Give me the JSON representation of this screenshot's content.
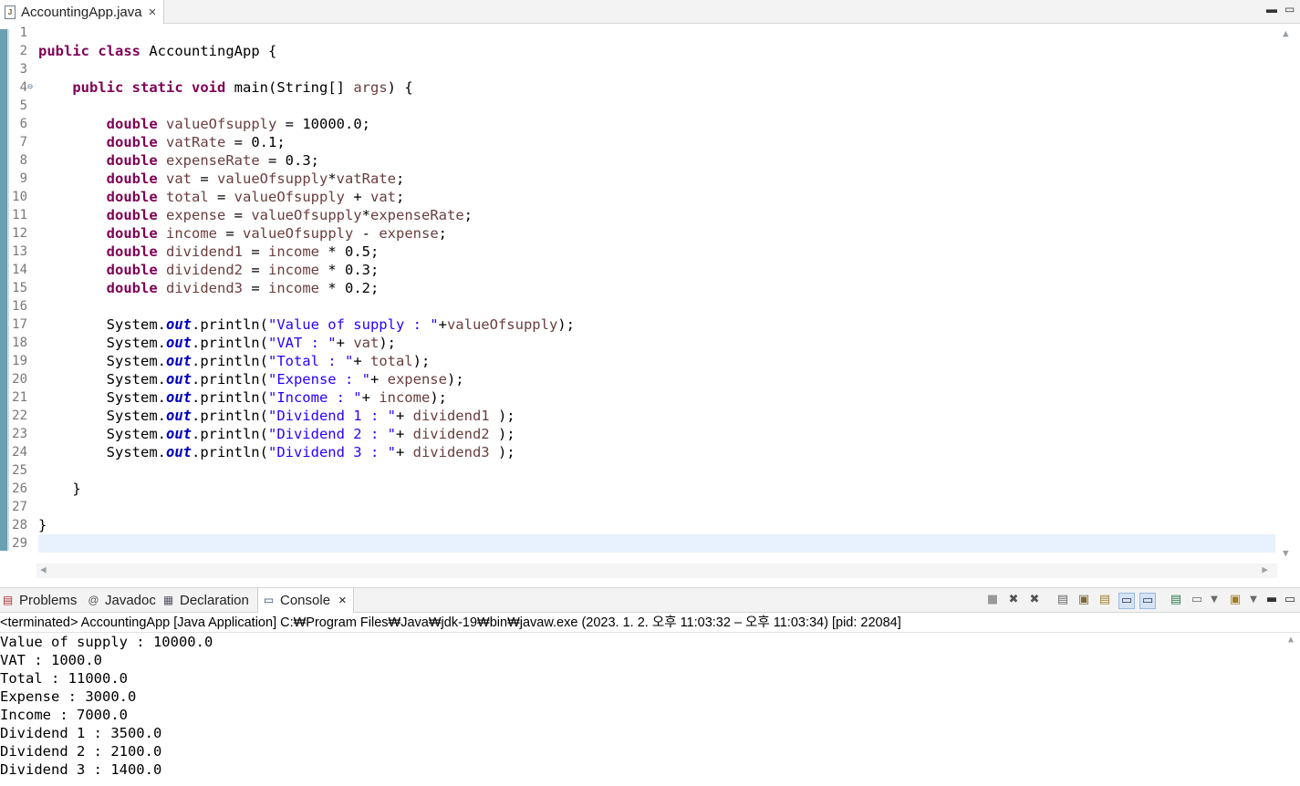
{
  "editor": {
    "tab": {
      "filename": "AccountingApp.java",
      "file_icon": "java-file-icon",
      "close": "×"
    },
    "window_buttons": {
      "minimize": "▬",
      "maximize": "▭"
    },
    "line_numbers": [
      "1",
      "2",
      "3",
      "4",
      "5",
      "6",
      "7",
      "8",
      "9",
      "10",
      "11",
      "12",
      "13",
      "14",
      "15",
      "16",
      "17",
      "18",
      "19",
      "20",
      "21",
      "22",
      "23",
      "24",
      "25",
      "26",
      "27",
      "28",
      "29"
    ],
    "fold_marker": "⊖",
    "current_line": 29,
    "code": [
      [],
      [
        {
          "t": "public",
          "c": "kw"
        },
        {
          "t": " "
        },
        {
          "t": "class",
          "c": "kw"
        },
        {
          "t": " AccountingApp {"
        }
      ],
      [],
      [
        {
          "t": "    "
        },
        {
          "t": "public",
          "c": "kw"
        },
        {
          "t": " "
        },
        {
          "t": "static",
          "c": "kw"
        },
        {
          "t": " "
        },
        {
          "t": "void",
          "c": "kw"
        },
        {
          "t": " main(String[] "
        },
        {
          "t": "args",
          "c": "var"
        },
        {
          "t": ") {"
        }
      ],
      [],
      [
        {
          "t": "        "
        },
        {
          "t": "double",
          "c": "kw"
        },
        {
          "t": " "
        },
        {
          "t": "valueOfsupply",
          "c": "var"
        },
        {
          "t": " = 10000.0;"
        }
      ],
      [
        {
          "t": "        "
        },
        {
          "t": "double",
          "c": "kw"
        },
        {
          "t": " "
        },
        {
          "t": "vatRate",
          "c": "var"
        },
        {
          "t": " = 0.1;"
        }
      ],
      [
        {
          "t": "        "
        },
        {
          "t": "double",
          "c": "kw"
        },
        {
          "t": " "
        },
        {
          "t": "expenseRate",
          "c": "var"
        },
        {
          "t": " = 0.3;"
        }
      ],
      [
        {
          "t": "        "
        },
        {
          "t": "double",
          "c": "kw"
        },
        {
          "t": " "
        },
        {
          "t": "vat",
          "c": "var"
        },
        {
          "t": " = "
        },
        {
          "t": "valueOfsupply",
          "c": "var"
        },
        {
          "t": "*"
        },
        {
          "t": "vatRate",
          "c": "var"
        },
        {
          "t": ";"
        }
      ],
      [
        {
          "t": "        "
        },
        {
          "t": "double",
          "c": "kw"
        },
        {
          "t": " "
        },
        {
          "t": "total",
          "c": "var"
        },
        {
          "t": " = "
        },
        {
          "t": "valueOfsupply",
          "c": "var"
        },
        {
          "t": " + "
        },
        {
          "t": "vat",
          "c": "var"
        },
        {
          "t": ";"
        }
      ],
      [
        {
          "t": "        "
        },
        {
          "t": "double",
          "c": "kw"
        },
        {
          "t": " "
        },
        {
          "t": "expense",
          "c": "var"
        },
        {
          "t": " = "
        },
        {
          "t": "valueOfsupply",
          "c": "var"
        },
        {
          "t": "*"
        },
        {
          "t": "expenseRate",
          "c": "var"
        },
        {
          "t": ";"
        }
      ],
      [
        {
          "t": "        "
        },
        {
          "t": "double",
          "c": "kw"
        },
        {
          "t": " "
        },
        {
          "t": "income",
          "c": "var"
        },
        {
          "t": " = "
        },
        {
          "t": "valueOfsupply",
          "c": "var"
        },
        {
          "t": " - "
        },
        {
          "t": "expense",
          "c": "var"
        },
        {
          "t": ";"
        }
      ],
      [
        {
          "t": "        "
        },
        {
          "t": "double",
          "c": "kw"
        },
        {
          "t": " "
        },
        {
          "t": "dividend1",
          "c": "var"
        },
        {
          "t": " = "
        },
        {
          "t": "income",
          "c": "var"
        },
        {
          "t": " * 0.5;"
        }
      ],
      [
        {
          "t": "        "
        },
        {
          "t": "double",
          "c": "kw"
        },
        {
          "t": " "
        },
        {
          "t": "dividend2",
          "c": "var"
        },
        {
          "t": " = "
        },
        {
          "t": "income",
          "c": "var"
        },
        {
          "t": " * 0.3;"
        }
      ],
      [
        {
          "t": "        "
        },
        {
          "t": "double",
          "c": "kw"
        },
        {
          "t": " "
        },
        {
          "t": "dividend3",
          "c": "var"
        },
        {
          "t": " = "
        },
        {
          "t": "income",
          "c": "var"
        },
        {
          "t": " * 0.2;"
        }
      ],
      [],
      [
        {
          "t": "        System."
        },
        {
          "t": "out",
          "c": "fld"
        },
        {
          "t": ".println("
        },
        {
          "t": "\"Value of supply : \"",
          "c": "str"
        },
        {
          "t": "+"
        },
        {
          "t": "valueOfsupply",
          "c": "var"
        },
        {
          "t": ");"
        }
      ],
      [
        {
          "t": "        System."
        },
        {
          "t": "out",
          "c": "fld"
        },
        {
          "t": ".println("
        },
        {
          "t": "\"VAT : \"",
          "c": "str"
        },
        {
          "t": "+ "
        },
        {
          "t": "vat",
          "c": "var"
        },
        {
          "t": ");"
        }
      ],
      [
        {
          "t": "        System."
        },
        {
          "t": "out",
          "c": "fld"
        },
        {
          "t": ".println("
        },
        {
          "t": "\"Total : \"",
          "c": "str"
        },
        {
          "t": "+ "
        },
        {
          "t": "total",
          "c": "var"
        },
        {
          "t": ");"
        }
      ],
      [
        {
          "t": "        System."
        },
        {
          "t": "out",
          "c": "fld"
        },
        {
          "t": ".println("
        },
        {
          "t": "\"Expense : \"",
          "c": "str"
        },
        {
          "t": "+ "
        },
        {
          "t": "expense",
          "c": "var"
        },
        {
          "t": ");"
        }
      ],
      [
        {
          "t": "        System."
        },
        {
          "t": "out",
          "c": "fld"
        },
        {
          "t": ".println("
        },
        {
          "t": "\"Income : \"",
          "c": "str"
        },
        {
          "t": "+ "
        },
        {
          "t": "income",
          "c": "var"
        },
        {
          "t": ");"
        }
      ],
      [
        {
          "t": "        System."
        },
        {
          "t": "out",
          "c": "fld"
        },
        {
          "t": ".println("
        },
        {
          "t": "\"Dividend 1 : \"",
          "c": "str"
        },
        {
          "t": "+ "
        },
        {
          "t": "dividend1",
          "c": "var"
        },
        {
          "t": " );"
        }
      ],
      [
        {
          "t": "        System."
        },
        {
          "t": "out",
          "c": "fld"
        },
        {
          "t": ".println("
        },
        {
          "t": "\"Dividend 2 : \"",
          "c": "str"
        },
        {
          "t": "+ "
        },
        {
          "t": "dividend2",
          "c": "var"
        },
        {
          "t": " );"
        }
      ],
      [
        {
          "t": "        System."
        },
        {
          "t": "out",
          "c": "fld"
        },
        {
          "t": ".println("
        },
        {
          "t": "\"Dividend 3 : \"",
          "c": "str"
        },
        {
          "t": "+ "
        },
        {
          "t": "dividend3",
          "c": "var"
        },
        {
          "t": " );"
        }
      ],
      [],
      [
        {
          "t": "    }"
        }
      ],
      [],
      [
        {
          "t": "}"
        }
      ],
      []
    ],
    "syntax_colors": {
      "keyword": "#7f0055",
      "local_variable": "#6a3e3e",
      "string": "#2a00ff",
      "static_field": "#0000c0"
    }
  },
  "views": {
    "tabs": [
      {
        "label": "Problems",
        "icon": "problems-icon"
      },
      {
        "label": "Javadoc",
        "icon": "javadoc-icon"
      },
      {
        "label": "Declaration",
        "icon": "declaration-icon"
      },
      {
        "label": "Console",
        "icon": "console-icon",
        "active": true,
        "close": "×"
      }
    ],
    "toolbar_icons": [
      "terminate-icon",
      "remove-launch-icon",
      "remove-all-terminated-icon",
      "clear-console-icon",
      "scroll-lock-icon",
      "word-wrap-icon",
      "show-stdout-icon",
      "show-stderr-icon",
      "pin-console-icon",
      "display-console-icon",
      "open-console-icon",
      "view-menu-icon",
      "minimize-icon",
      "maximize-icon"
    ]
  },
  "console": {
    "status": "<terminated> AccountingApp [Java Application] C:₩Program Files₩Java₩jdk-19₩bin₩javaw.exe  (2023. 1. 2. 오후 11:03:32 – 오후 11:03:34) [pid: 22084]",
    "output": [
      "Value of supply : 10000.0",
      "VAT : 1000.0",
      "Total : 11000.0",
      "Expense : 3000.0",
      "Income : 7000.0",
      "Dividend 1 : 3500.0",
      "Dividend 2 : 2100.0",
      "Dividend 3 : 1400.0"
    ]
  }
}
